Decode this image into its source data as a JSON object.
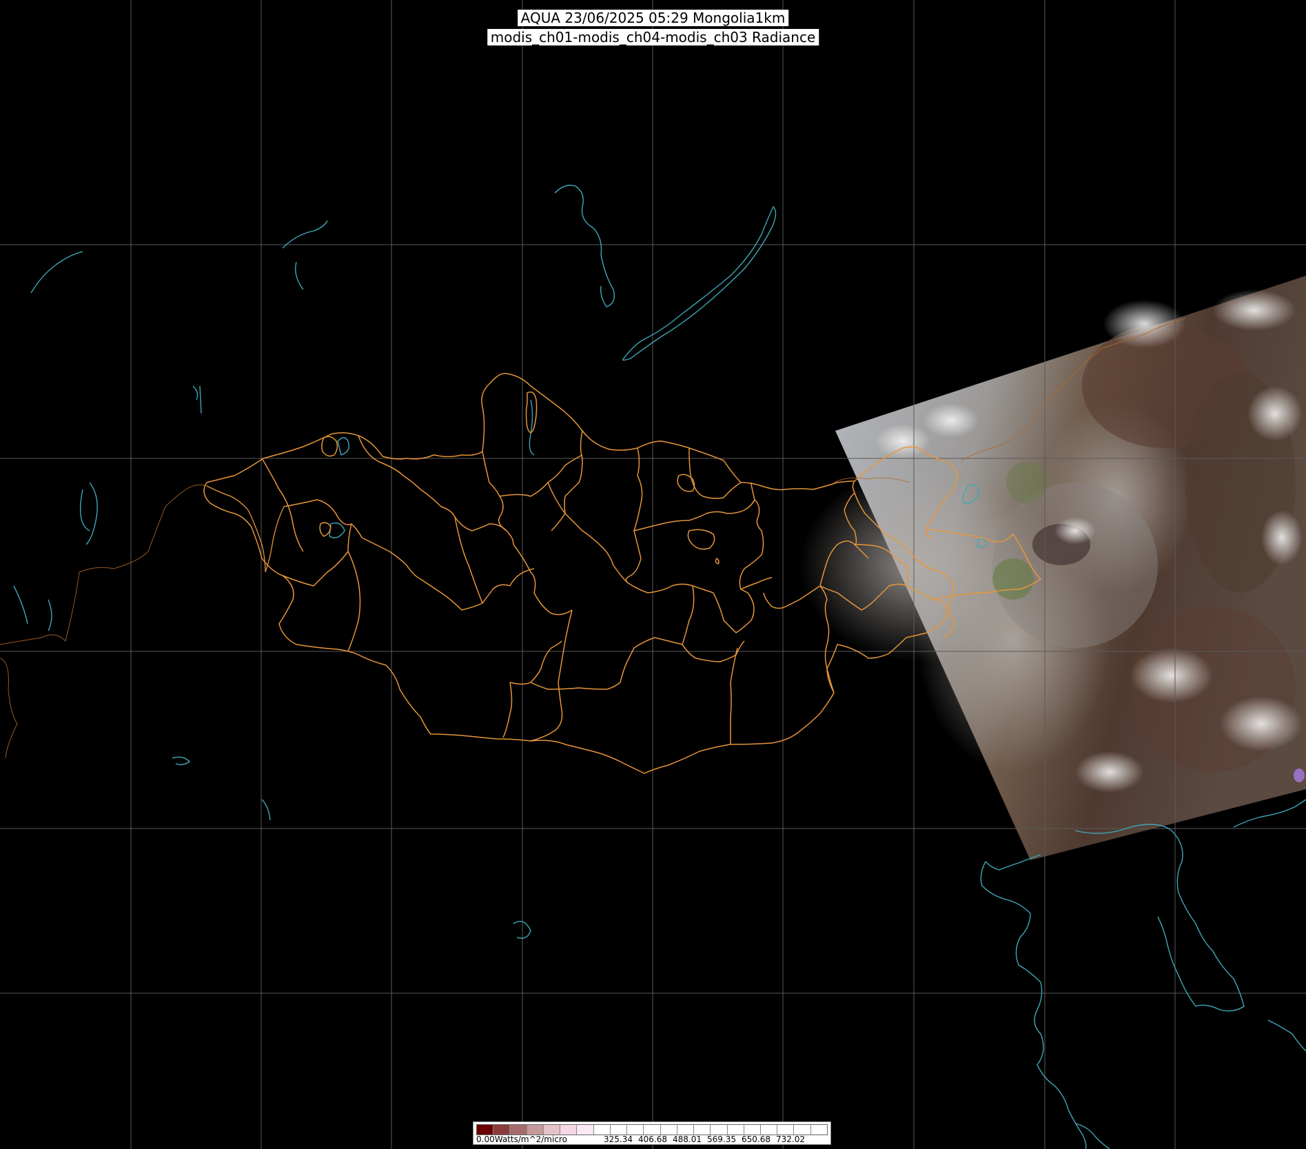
{
  "title": {
    "line1": "AQUA 23/06/2025 05:29 Mongolia1km",
    "line2": "modis_ch01-modis_ch04-modis_ch03 Radiance"
  },
  "legend": {
    "min_label": "0.00Watts/m^2/micro",
    "tick_labels": [
      "325.34",
      "406.68",
      "488.01",
      "569.35",
      "650.68",
      "732.02"
    ],
    "swatch_colors": [
      "#6b0000",
      "#8a3c3c",
      "#a56b6b",
      "#c49a9a",
      "#e6c3c8",
      "#f5d8e6",
      "#fbe9f5",
      "#ffffff",
      "#ffffff",
      "#ffffff",
      "#ffffff",
      "#ffffff",
      "#ffffff",
      "#ffffff",
      "#ffffff",
      "#ffffff",
      "#ffffff",
      "#ffffff",
      "#ffffff",
      "#ffffff",
      "#ffffff"
    ]
  },
  "colors": {
    "background": "#000000",
    "graticule": "#5a5a5a",
    "province_border": "#e8963a",
    "coastline": "#3fa7b8",
    "satellite_haze": "#a8a8a8",
    "satellite_forest": "#4a3a30"
  }
}
